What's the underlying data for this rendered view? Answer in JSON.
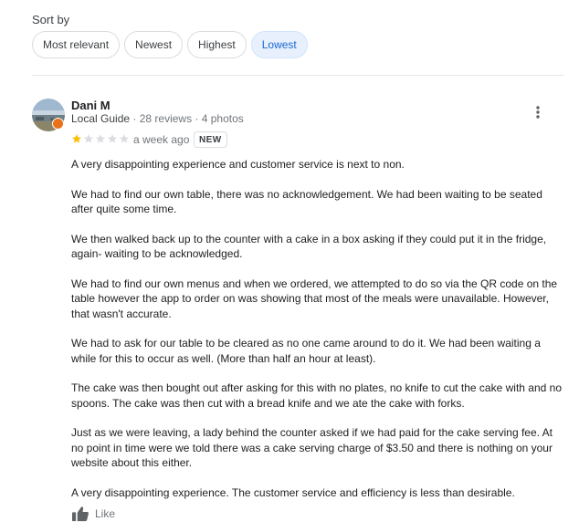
{
  "sort": {
    "label": "Sort by",
    "options": [
      {
        "label": "Most relevant",
        "active": false
      },
      {
        "label": "Newest",
        "active": false
      },
      {
        "label": "Highest",
        "active": false
      },
      {
        "label": "Lowest",
        "active": true
      }
    ]
  },
  "review": {
    "reviewer_name": "Dani M",
    "reviewer_badge": "Local Guide",
    "reviewer_stats": " · 28 reviews · 4 photos",
    "rating": 1,
    "rating_max": 5,
    "time": "a week ago",
    "badge": "NEW",
    "paragraphs": [
      "A very disappointing experience and customer service is next to non.",
      "We had to find our own table, there was no acknowledgement. We had been waiting to be seated after quite some time.",
      "We then walked back up to the counter with a cake in a box asking if they could put it in the fridge, again- waiting to be acknowledged.",
      "We had to find our own menus and when we ordered, we attempted to do so via the QR code on the table however the app to order on was showing that most of the meals were unavailable. However, that wasn't accurate.",
      "We had to ask for our table to be cleared as no one came around to do it. We had been waiting a while for this to occur as well. (More than half an hour at least).",
      "The cake was then bought out after asking for this with no plates, no knife to cut the cake with and no spoons. The cake was then cut with a bread knife and we ate the cake with forks.",
      "Just as we were leaving, a lady behind the counter asked if we had paid for the cake serving fee. At no point in time were we told there was a cake serving charge of $3.50 and there is nothing on your website about this either.",
      "A very disappointing experience. The customer service and efficiency is less than desirable."
    ],
    "like_label": "Like"
  },
  "colors": {
    "star_filled": "#fbbc04",
    "star_empty": "#dadce0",
    "active_chip_bg": "#e8f0fe",
    "active_chip_text": "#1967d2",
    "local_guide_badge": "#e8711a"
  },
  "icons": {
    "more": "more-vert-icon",
    "like": "thumb-up-icon",
    "star": "star-icon"
  }
}
